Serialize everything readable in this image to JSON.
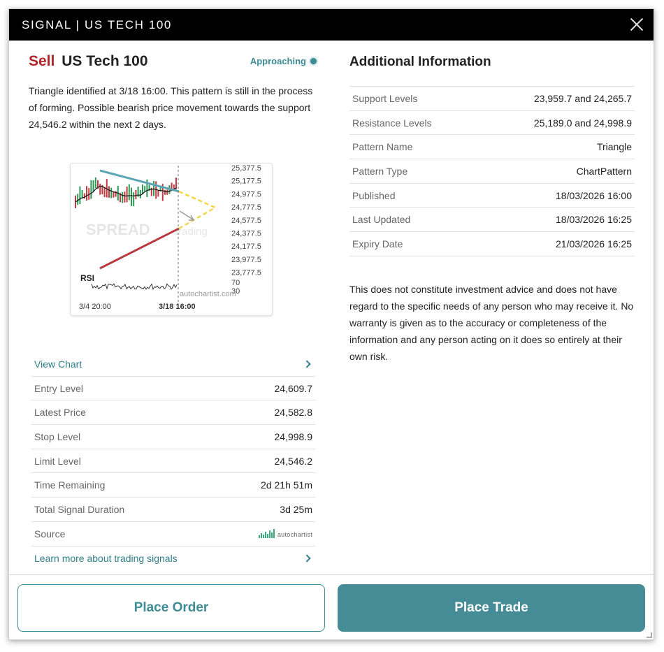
{
  "title": "SIGNAL | US TECH 100",
  "signal": {
    "direction": "Sell",
    "instrument": "US Tech 100",
    "status": "Approaching",
    "description": "Triangle identified at 3/18 16:00. This pattern is still in the process of forming. Possible bearish price movement towards the support 24,546.2 within the next 2 days."
  },
  "chart": {
    "y_ticks": [
      "25,377.5",
      "25,177.5",
      "24,977.5",
      "24,777.5",
      "24,577.5",
      "24,377.5",
      "24,177.5",
      "23,977.5",
      "23,777.5"
    ],
    "rsi_label": "RSI",
    "rsi_ticks": [
      "70",
      "30"
    ],
    "x_ticks": [
      "3/4 20:00",
      "3/18 16:00"
    ],
    "watermark": "SPREAD",
    "watermark2": "trading",
    "credit": "autochartist.com",
    "colors": {
      "resistance": "#5aa6b5",
      "support": "#b9373f",
      "projection": "#f2d541",
      "candle_up": "#2b9a56",
      "candle_down": "#c43a40"
    }
  },
  "details": {
    "view_chart": "View Chart",
    "rows": [
      {
        "label": "Entry Level",
        "value": "24,609.7"
      },
      {
        "label": "Latest Price",
        "value": "24,582.8"
      },
      {
        "label": "Stop Level",
        "value": "24,998.9"
      },
      {
        "label": "Limit Level",
        "value": "24,546.2"
      },
      {
        "label": "Time Remaining",
        "value": "2d 21h 51m"
      },
      {
        "label": "Total Signal Duration",
        "value": "3d 25m"
      }
    ],
    "source_label": "Source",
    "source_logo": "autochartist",
    "learn_more": "Learn more about trading signals"
  },
  "additional": {
    "heading": "Additional Information",
    "rows": [
      {
        "label": "Support Levels",
        "value": "23,959.7 and 24,265.7"
      },
      {
        "label": "Resistance Levels",
        "value": "25,189.0 and 24,998.9"
      },
      {
        "label": "Pattern Name",
        "value": "Triangle"
      },
      {
        "label": "Pattern Type",
        "value": "ChartPattern"
      },
      {
        "label": "Published",
        "value": "18/03/2026 16:00"
      },
      {
        "label": "Last Updated",
        "value": "18/03/2026 16:25"
      },
      {
        "label": "Expiry Date",
        "value": "21/03/2026 16:25"
      }
    ],
    "disclaimer": "This does not constitute investment advice and does not have regard to the specific needs of any person who may receive it. No warranty is given as to the accuracy or completeness of the information and any person acting on it does so entirely at their own risk."
  },
  "buttons": {
    "place_order": "Place Order",
    "place_trade": "Place Trade"
  }
}
